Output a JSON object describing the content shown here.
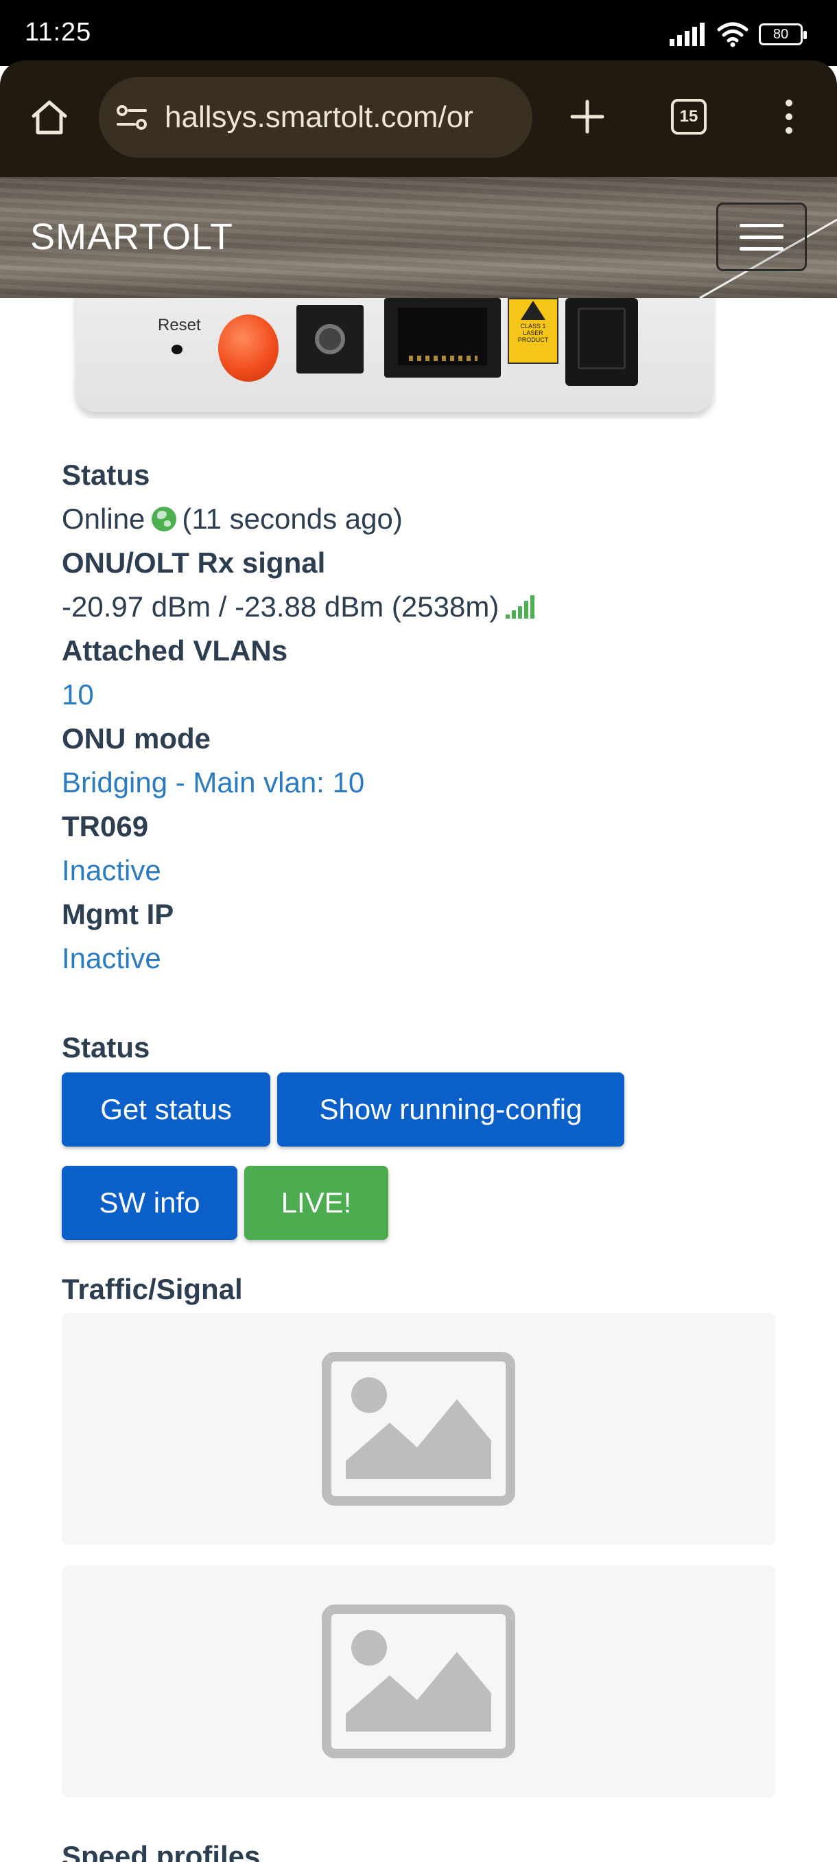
{
  "status_bar": {
    "time": "11:25",
    "battery": "80"
  },
  "browser": {
    "url": "hallsys.smartolt.com/or",
    "tab_count": "15"
  },
  "navbar": {
    "brand": "SMARTOLT"
  },
  "device": {
    "reset_label": "Reset",
    "laser_label": "CLASS 1 LASER PRODUCT"
  },
  "details": [
    {
      "label": "Status",
      "value": "Online",
      "extra": "(11 seconds ago)"
    },
    {
      "label": "ONU/OLT Rx signal",
      "value": "-20.97 dBm / -23.88 dBm (2538m)"
    },
    {
      "label": "Attached VLANs",
      "value": "10"
    },
    {
      "label": "ONU mode",
      "value": "Bridging - Main vlan: 10"
    },
    {
      "label": "TR069",
      "value": "Inactive"
    },
    {
      "label": "Mgmt IP",
      "value": "Inactive"
    }
  ],
  "status_section": {
    "title": "Status",
    "buttons": {
      "get_status": "Get status",
      "show_running_config": "Show running-config",
      "sw_info": "SW info",
      "live": "LIVE!"
    }
  },
  "traffic_section": {
    "title": "Traffic/Signal"
  },
  "speed_section": {
    "title": "Speed profiles"
  },
  "colors": {
    "primary": "#0a60c8",
    "success": "#4cad50",
    "link": "#2a7bc0",
    "text": "#2c3e50"
  }
}
